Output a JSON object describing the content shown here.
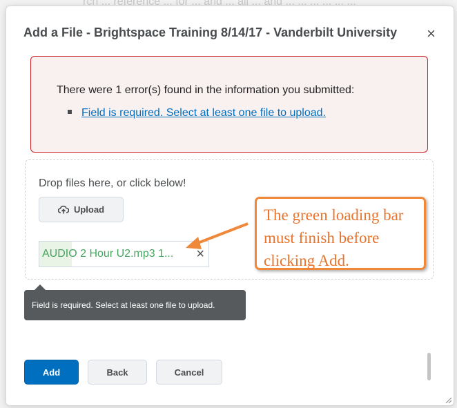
{
  "dialog": {
    "title": "Add a File - Brightspace Training 8/14/17 - Vanderbilt University",
    "close_icon": "×"
  },
  "error": {
    "message": "There were 1 error(s) found in the information you submitted:",
    "items": [
      {
        "label": "Field is required. Select at least one file to upload."
      }
    ]
  },
  "dropzone": {
    "prompt": "Drop files here, or click below!",
    "upload_label": "Upload",
    "upload_icon": "cloud-upload-icon"
  },
  "file": {
    "name": "AUDIO 2 Hour U2.mp3 1...",
    "remove_icon": "×",
    "progress": 0.19
  },
  "tooltip": {
    "text": "Field is required. Select at least one file to upload."
  },
  "annotation": {
    "lines": [
      "The green loading bar",
      "must finish before",
      "clicking Add."
    ]
  },
  "footer": {
    "add_label": "Add",
    "back_label": "Back",
    "cancel_label": "Cancel"
  },
  "colors": {
    "primary": "#006fbf",
    "error_border": "#cd2026",
    "progress_green": "#46a661",
    "annotation_orange": "#e8742d"
  }
}
